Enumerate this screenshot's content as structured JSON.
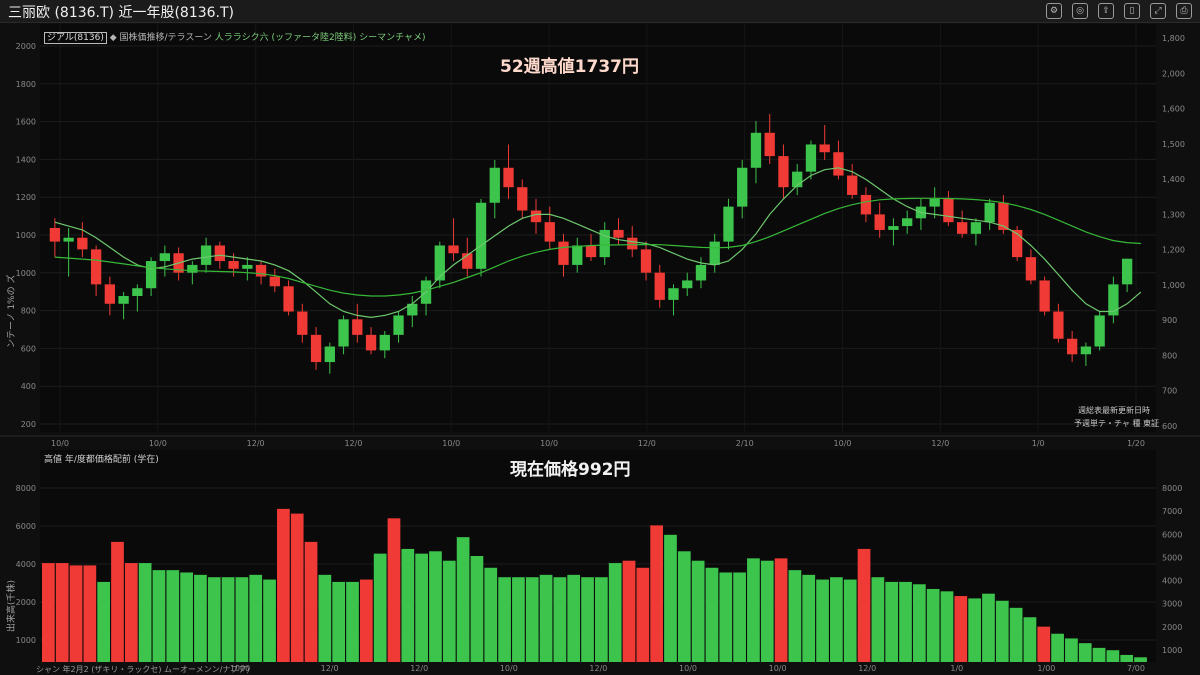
{
  "window": {
    "title": "三丽欧 (8136.T) 近一年股(8136.T)",
    "icons": [
      "settings-icon",
      "camera-icon",
      "share-icon",
      "bookmark-icon",
      "fullscreen-icon",
      "print-icon"
    ]
  },
  "colors": {
    "up": "#3cc44c",
    "down": "#f03a35",
    "ma_short": "#6ec86e",
    "ma_long": "#37b837",
    "background": "#0a0a0a"
  },
  "price_panel": {
    "legend_box": "ジアル(8136)",
    "legend_line2": "◆ 国株価推移/テラスーン",
    "legend_line3": "人ララシク六 (ッファータ陸2陸料) シーマンチャメ)",
    "high_label": "52週高値1737円",
    "ylabel": "ンテーノ 1%の ズ",
    "note1": "週総表最新更新日時",
    "note2": "予週単テ・チャ 種 東証"
  },
  "volume_panel": {
    "legend": "高値 年/度都価格配前 (学在)",
    "price_label": "現在価格992円",
    "ylabel": "出来高(千株)",
    "footer": "シャン 年2月2 (ザキリ・ラックセ) ムーオーメンン/ナブア)"
  },
  "chart_data": [
    {
      "type": "candlestick",
      "title": "52週高値1737円",
      "xlabel": "",
      "ylabel": "",
      "x_ticks": [
        "10/0",
        "10/0",
        "12/0",
        "12/0",
        "10/0",
        "10/0",
        "12/0",
        "2/10",
        "10/0",
        "12/0",
        "1/0",
        "1/20"
      ],
      "y_ticks_left": [
        "2000",
        "1800",
        "1600",
        "1400",
        "1200",
        "1000",
        "1000",
        "800",
        "600",
        "400",
        "200"
      ],
      "y_ticks_right": [
        "1,800",
        "2,000",
        "1,600",
        "1,500",
        "1,400",
        "1,300",
        "1,200",
        "1,000",
        "900",
        "800",
        "700",
        "600"
      ],
      "ylim": [
        100,
        2200
      ],
      "ohlc": [
        [
          1150,
          1200,
          1000,
          1080
        ],
        [
          1080,
          1150,
          900,
          1100
        ],
        [
          1100,
          1180,
          1000,
          1040
        ],
        [
          1040,
          1060,
          800,
          860
        ],
        [
          860,
          900,
          700,
          760
        ],
        [
          760,
          820,
          680,
          800
        ],
        [
          800,
          860,
          720,
          840
        ],
        [
          840,
          1000,
          800,
          980
        ],
        [
          980,
          1060,
          900,
          1020
        ],
        [
          1020,
          1050,
          880,
          920
        ],
        [
          920,
          980,
          860,
          960
        ],
        [
          960,
          1100,
          920,
          1060
        ],
        [
          1060,
          1080,
          940,
          980
        ],
        [
          980,
          1020,
          900,
          940
        ],
        [
          940,
          1000,
          880,
          960
        ],
        [
          960,
          980,
          860,
          900
        ],
        [
          900,
          940,
          820,
          850
        ],
        [
          850,
          880,
          700,
          720
        ],
        [
          720,
          760,
          560,
          600
        ],
        [
          600,
          640,
          420,
          460
        ],
        [
          460,
          560,
          400,
          540
        ],
        [
          540,
          700,
          500,
          680
        ],
        [
          680,
          760,
          560,
          600
        ],
        [
          600,
          640,
          500,
          520
        ],
        [
          520,
          620,
          480,
          600
        ],
        [
          600,
          720,
          560,
          700
        ],
        [
          700,
          800,
          640,
          760
        ],
        [
          760,
          900,
          700,
          880
        ],
        [
          880,
          1080,
          840,
          1060
        ],
        [
          1060,
          1200,
          980,
          1020
        ],
        [
          1020,
          1100,
          900,
          940
        ],
        [
          940,
          1300,
          900,
          1280
        ],
        [
          1280,
          1500,
          1200,
          1460
        ],
        [
          1460,
          1580,
          1300,
          1360
        ],
        [
          1360,
          1400,
          1200,
          1240
        ],
        [
          1240,
          1300,
          1120,
          1180
        ],
        [
          1180,
          1260,
          1040,
          1080
        ],
        [
          1080,
          1120,
          900,
          960
        ],
        [
          960,
          1100,
          920,
          1060
        ],
        [
          1060,
          1120,
          980,
          1000
        ],
        [
          1000,
          1180,
          960,
          1140
        ],
        [
          1140,
          1200,
          1060,
          1100
        ],
        [
          1100,
          1160,
          1000,
          1040
        ],
        [
          1040,
          1080,
          880,
          920
        ],
        [
          920,
          960,
          740,
          780
        ],
        [
          780,
          860,
          700,
          840
        ],
        [
          840,
          920,
          800,
          880
        ],
        [
          880,
          1000,
          840,
          960
        ],
        [
          960,
          1120,
          920,
          1080
        ],
        [
          1080,
          1300,
          1040,
          1260
        ],
        [
          1260,
          1500,
          1200,
          1460
        ],
        [
          1460,
          1700,
          1380,
          1640
        ],
        [
          1640,
          1737,
          1480,
          1520
        ],
        [
          1520,
          1580,
          1300,
          1360
        ],
        [
          1360,
          1480,
          1320,
          1440
        ],
        [
          1440,
          1600,
          1400,
          1580
        ],
        [
          1580,
          1680,
          1500,
          1540
        ],
        [
          1540,
          1600,
          1400,
          1420
        ],
        [
          1420,
          1480,
          1300,
          1320
        ],
        [
          1320,
          1360,
          1180,
          1220
        ],
        [
          1220,
          1280,
          1100,
          1140
        ],
        [
          1140,
          1200,
          1060,
          1160
        ],
        [
          1160,
          1240,
          1120,
          1200
        ],
        [
          1200,
          1300,
          1140,
          1260
        ],
        [
          1260,
          1360,
          1200,
          1300
        ],
        [
          1300,
          1340,
          1160,
          1180
        ],
        [
          1180,
          1240,
          1100,
          1120
        ],
        [
          1120,
          1200,
          1060,
          1180
        ],
        [
          1180,
          1300,
          1140,
          1280
        ],
        [
          1280,
          1320,
          1120,
          1140
        ],
        [
          1140,
          1160,
          980,
          1000
        ],
        [
          1000,
          1040,
          860,
          880
        ],
        [
          880,
          900,
          700,
          720
        ],
        [
          720,
          760,
          560,
          580
        ],
        [
          580,
          620,
          460,
          500
        ],
        [
          500,
          560,
          440,
          540
        ],
        [
          540,
          720,
          520,
          700
        ],
        [
          700,
          900,
          660,
          860
        ],
        [
          860,
          992,
          820,
          992
        ]
      ],
      "series": [
        {
          "name": "",
          "values": [
            1180,
            1160,
            1140,
            1100,
            1050,
            1000,
            960,
            940,
            950,
            970,
            990,
            1000,
            1010,
            1000,
            990,
            980,
            960,
            930,
            880,
            820,
            760,
            720,
            700,
            690,
            700,
            720,
            760,
            820,
            900,
            960,
            1010,
            1060,
            1110,
            1160,
            1200,
            1220,
            1220,
            1200,
            1170,
            1140,
            1110,
            1090,
            1080,
            1070,
            1050,
            1020,
            990,
            970,
            960,
            980,
            1040,
            1120,
            1220,
            1300,
            1370,
            1420,
            1450,
            1460,
            1440,
            1400,
            1350,
            1300,
            1260,
            1230,
            1220,
            1210,
            1200,
            1190,
            1180,
            1160,
            1120,
            1060,
            990,
            910,
            830,
            760,
            720,
            720,
            760,
            820
          ]
        },
        {
          "name": "",
          "values": [
            1000,
            995,
            990,
            985,
            975,
            965,
            955,
            945,
            940,
            935,
            930,
            928,
            926,
            924,
            920,
            915,
            905,
            890,
            870,
            850,
            830,
            815,
            805,
            800,
            800,
            805,
            815,
            830,
            850,
            870,
            895,
            920,
            950,
            980,
            1005,
            1025,
            1040,
            1050,
            1055,
            1060,
            1062,
            1063,
            1064,
            1065,
            1064,
            1060,
            1055,
            1050,
            1048,
            1050,
            1060,
            1080,
            1105,
            1135,
            1165,
            1195,
            1225,
            1250,
            1270,
            1285,
            1295,
            1300,
            1302,
            1303,
            1303,
            1302,
            1300,
            1296,
            1290,
            1280,
            1265,
            1245,
            1220,
            1190,
            1160,
            1130,
            1105,
            1085,
            1075,
            1070
          ]
        }
      ]
    },
    {
      "type": "bar",
      "title": "現在価格992円",
      "xlabel": "",
      "ylabel": "",
      "x_ticks": [
        "1000",
        "12/0",
        "12/0",
        "10/0",
        "12/0",
        "10/0",
        "10/0",
        "12/0",
        "1/0",
        "1/00",
        "7/00"
      ],
      "y_ticks_left": [
        "8000",
        "6000",
        "4000",
        "2000",
        "1000"
      ],
      "y_ticks_right": [
        "8000",
        "7000",
        "6000",
        "5000",
        "4000",
        "3000",
        "2000",
        "1000"
      ],
      "ylim": [
        0,
        9000
      ],
      "values": [
        4200,
        4200,
        4100,
        4100,
        3400,
        5100,
        4200,
        4200,
        3900,
        3900,
        3800,
        3700,
        3600,
        3600,
        3600,
        3700,
        3500,
        6500,
        6300,
        5100,
        3700,
        3400,
        3400,
        3500,
        4600,
        6100,
        4800,
        4600,
        4700,
        4300,
        5300,
        4500,
        4000,
        3600,
        3600,
        3600,
        3700,
        3600,
        3700,
        3600,
        3600,
        4200,
        4300,
        4000,
        5800,
        5400,
        4700,
        4300,
        4000,
        3800,
        3800,
        4400,
        4300,
        4400,
        3900,
        3700,
        3500,
        3600,
        3500,
        4800,
        3600,
        3400,
        3400,
        3300,
        3100,
        3000,
        2800,
        2700,
        2900,
        2600,
        2300,
        1900,
        1500,
        1200,
        1000,
        800,
        600,
        500,
        300,
        200
      ],
      "directions": [
        "down",
        "down",
        "down",
        "down",
        "up",
        "down",
        "down",
        "up",
        "up",
        "up",
        "up",
        "up",
        "up",
        "up",
        "up",
        "up",
        "up",
        "down",
        "down",
        "down",
        "up",
        "up",
        "up",
        "down",
        "up",
        "down",
        "up",
        "up",
        "up",
        "up",
        "up",
        "up",
        "up",
        "up",
        "up",
        "up",
        "up",
        "up",
        "up",
        "up",
        "up",
        "up",
        "down",
        "down",
        "down",
        "up",
        "up",
        "up",
        "up",
        "up",
        "up",
        "up",
        "up",
        "down",
        "up",
        "up",
        "up",
        "up",
        "up",
        "down",
        "up",
        "up",
        "up",
        "up",
        "up",
        "up",
        "down",
        "up",
        "up",
        "up",
        "up",
        "up",
        "down",
        "up",
        "up",
        "up",
        "up",
        "up",
        "up",
        "up"
      ]
    }
  ]
}
